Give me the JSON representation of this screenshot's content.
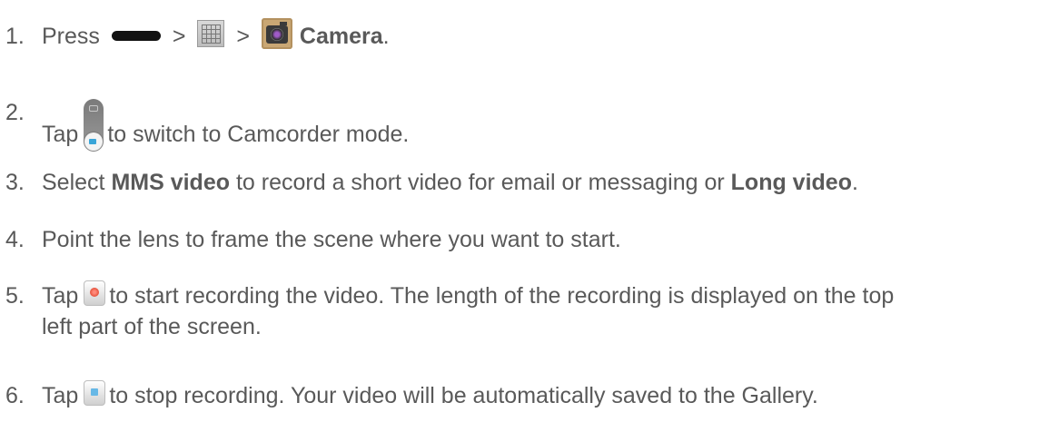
{
  "steps": [
    {
      "number": "1.",
      "press": "Press",
      "sep1": ">",
      "sep2": ">",
      "camera_label": "Camera",
      "end": "."
    },
    {
      "number": "2.",
      "tap": "Tap",
      "text": "to switch to Camcorder mode."
    },
    {
      "number": "3.",
      "text_a": "Select ",
      "bold_a": "MMS video",
      "text_b": " to record a short video for email or messaging or ",
      "bold_b": "Long video",
      "end": "."
    },
    {
      "number": "4.",
      "text": "Point the lens to frame the scene where you want to start."
    },
    {
      "number": "5.",
      "tap": "Tap",
      "text": "to start recording the video. The length of the recording is displayed on the top",
      "text_cont": "left part of the screen."
    },
    {
      "number": "6.",
      "tap": "Tap",
      "text": "to stop recording. Your video will be automatically saved to the Gallery."
    }
  ],
  "icons": {
    "home_key": "home-key-icon",
    "apps": "apps-icon",
    "camera": "camera-app-icon",
    "mode_switch": "camcorder-mode-switch-icon",
    "record": "record-button-icon",
    "stop": "stop-button-icon"
  }
}
